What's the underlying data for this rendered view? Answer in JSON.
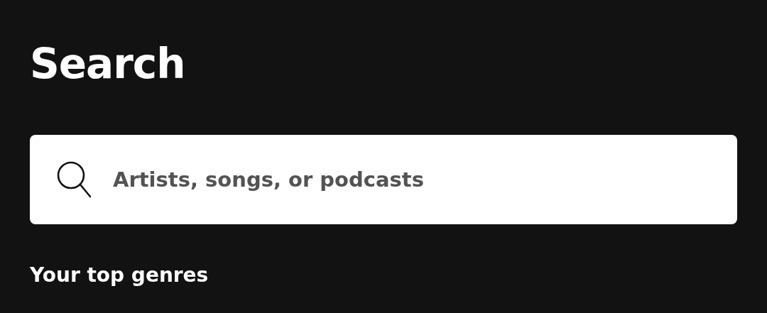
{
  "title": "Search",
  "search": {
    "placeholder": "Artists, songs, or podcasts"
  },
  "section": {
    "heading": "Your top genres"
  }
}
